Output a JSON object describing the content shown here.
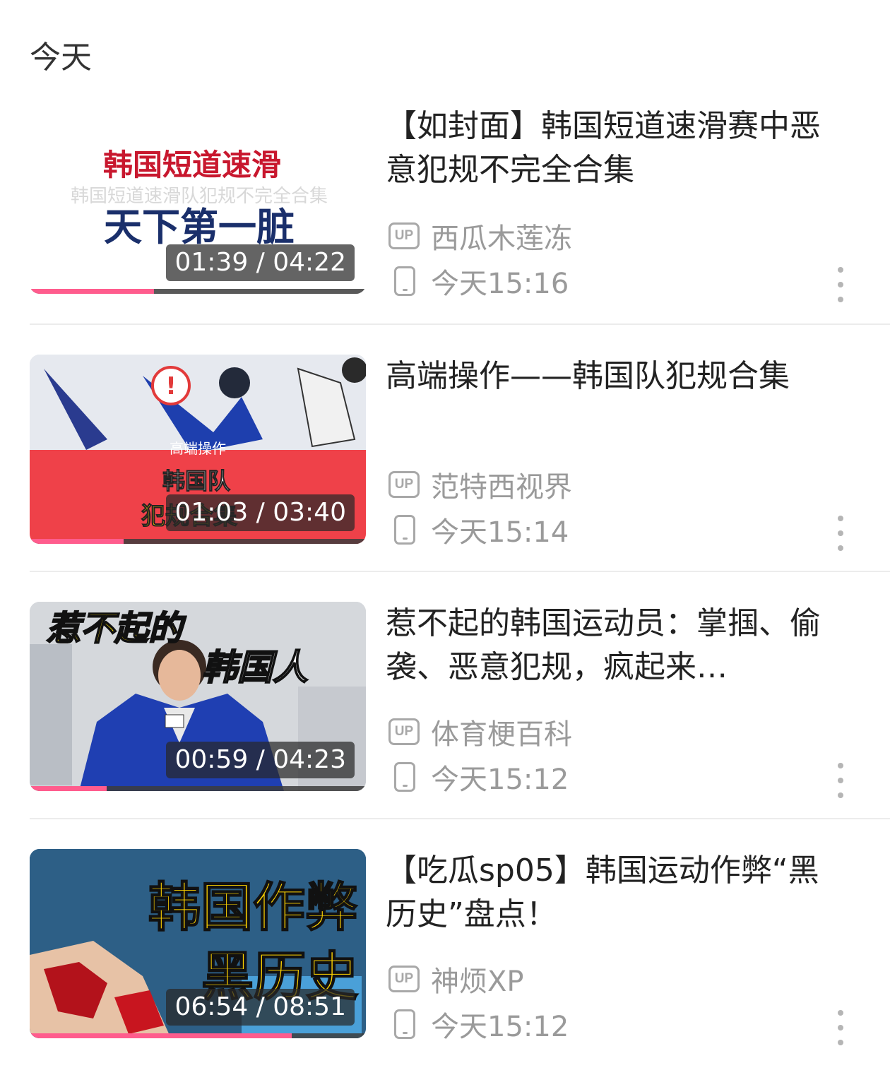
{
  "section": {
    "title": "今天"
  },
  "items": [
    {
      "title": "【如封面】韩国短道速滑赛中恶意犯规不完全合集",
      "uploader": "西瓜木莲冻",
      "time": "今天15:16",
      "duration": "01:39 / 04:22",
      "progress": 0.37,
      "thumb_text": {
        "line1": "韩国短道速滑",
        "sub": "韩国短道速滑队犯规不完全合集",
        "line2": "天下第一脏"
      }
    },
    {
      "title": "高端操作——韩国队犯规合集",
      "uploader": "范特西视界",
      "time": "今天15:14",
      "duration": "01:03 / 03:40",
      "progress": 0.28,
      "thumb_text": {
        "small": "高端操作",
        "line1": "韩国队",
        "line2": "犯规合集"
      }
    },
    {
      "title": "惹不起的韩国运动员：掌掴、偷袭、恶意犯规，疯起来…",
      "uploader": "体育梗百科",
      "time": "今天15:12",
      "duration": "00:59 / 04:23",
      "progress": 0.23,
      "thumb_text": {
        "line1": "惹不起的",
        "line2": "韩国人"
      }
    },
    {
      "title": "【吃瓜sp05】韩国运动作弊“黑历史”盘点！",
      "uploader": "神烦XP",
      "time": "今天15:12",
      "duration": "06:54 / 08:51",
      "progress": 0.78,
      "thumb_text": {
        "line1": "韩国作弊",
        "line2": "黑历史"
      }
    }
  ],
  "labels": {
    "up_badge": "UP"
  },
  "colors": {
    "accent": "#ff5c8d",
    "meta": "#9a9a9a"
  },
  "icons": {
    "up": "up-badge-icon",
    "device": "phone-icon",
    "more": "more-vertical-icon"
  }
}
